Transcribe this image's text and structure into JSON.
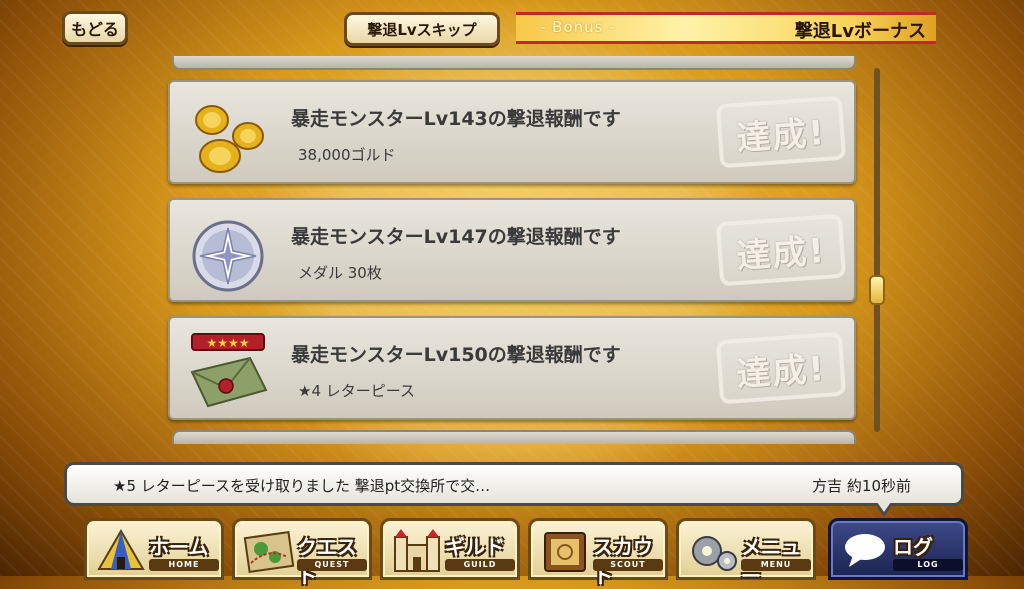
{
  "header": {
    "back_label": "もどる",
    "skip_label": "撃退Lvスキップ",
    "bonus_sub": "- Bonus -",
    "bonus_title": "撃退Lvボーナス"
  },
  "rewards": [
    {
      "title": "暴走モンスターLv143の撃退報酬です",
      "detail": "38,000ゴルド",
      "icon": "gold-coins-icon",
      "stamp": "達成!"
    },
    {
      "title": "暴走モンスターLv147の撃退報酬です",
      "detail": "メダル 30枚",
      "icon": "medal-icon",
      "stamp": "達成!"
    },
    {
      "title": "暴走モンスターLv150の撃退報酬です",
      "detail": "★4 レターピース",
      "icon": "letter-piece-icon",
      "stamp": "達成!"
    }
  ],
  "scroll": {
    "position_fraction": 0.62
  },
  "log": {
    "message": "★5 レターピースを受け取りました 撃退pt交換所で交…",
    "meta": "方吉 約10秒前"
  },
  "nav": [
    {
      "label": "ホーム",
      "sub": "HOME",
      "icon": "tent-icon",
      "active": false
    },
    {
      "label": "クエスト",
      "sub": "QUEST",
      "icon": "map-icon",
      "active": false
    },
    {
      "label": "ギルド",
      "sub": "GUILD",
      "icon": "castle-icon",
      "active": false
    },
    {
      "label": "スカウト",
      "sub": "SCOUT",
      "icon": "book-icon",
      "active": false
    },
    {
      "label": "メニュー",
      "sub": "MENU",
      "icon": "gear-icon",
      "active": false
    },
    {
      "label": "ログ",
      "sub": "LOG",
      "icon": "speech-bubble-icon",
      "active": true
    }
  ],
  "colors": {
    "accent_red": "#c0282a",
    "gold": "#e3b53a",
    "nav_active": "#1c2452"
  }
}
